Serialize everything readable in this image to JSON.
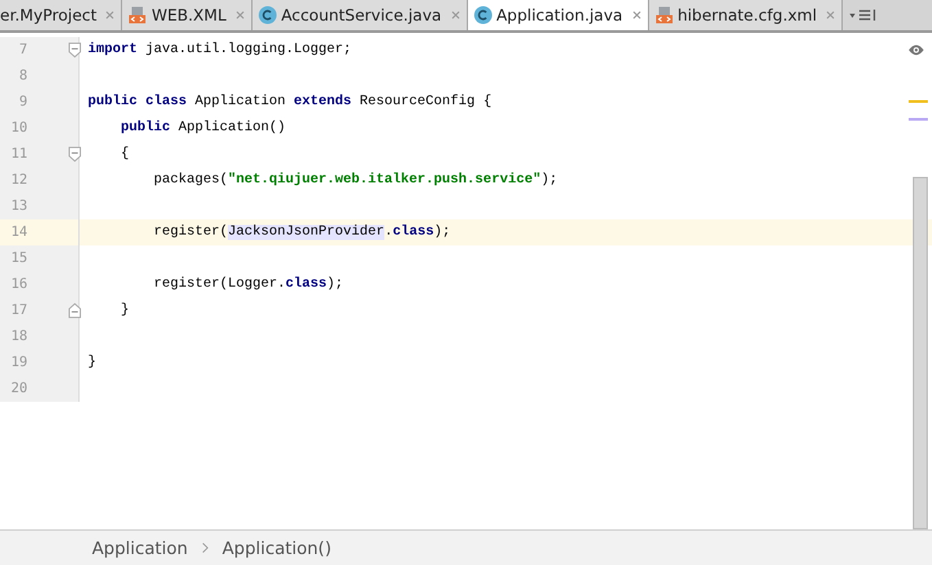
{
  "tabs": [
    {
      "label": "er.MyProject",
      "kind": "plain",
      "selected": false
    },
    {
      "label": "WEB.XML",
      "kind": "xml",
      "selected": false
    },
    {
      "label": "AccountService.java",
      "kind": "class",
      "selected": false
    },
    {
      "label": "Application.java",
      "kind": "class",
      "selected": true
    },
    {
      "label": "hibernate.cfg.xml",
      "kind": "xml",
      "selected": false
    }
  ],
  "code_lines": [
    {
      "number": "7",
      "current": false,
      "kind": "fold-start",
      "tokens": [
        {
          "kind": "keyword",
          "text": "import"
        },
        {
          "kind": "plain",
          "text": " java.util.logging.Logger;"
        }
      ]
    },
    {
      "number": "8",
      "current": false,
      "kind": "plain"
    },
    {
      "number": "9",
      "current": false,
      "kind": "plain",
      "tokens": [
        {
          "kind": "keyword",
          "text": "public class"
        },
        {
          "kind": "plain",
          "text": " Application "
        },
        {
          "kind": "keyword",
          "text": "extends"
        },
        {
          "kind": "plain",
          "text": " ResourceConfig {"
        }
      ]
    },
    {
      "number": "10",
      "current": false,
      "kind": "plain",
      "tokens": [
        {
          "kind": "keyword",
          "text": "    public"
        },
        {
          "kind": "plain",
          "text": " Application()"
        }
      ]
    },
    {
      "number": "11",
      "current": false,
      "kind": "fold-start",
      "tokens": [
        {
          "kind": "plain",
          "text": "    {"
        }
      ]
    },
    {
      "number": "12",
      "current": false,
      "kind": "plain",
      "tokens": [
        {
          "kind": "plain",
          "text": "        packages("
        },
        {
          "kind": "string",
          "text": "\"net.qiujuer.web.italker.push.service\""
        },
        {
          "kind": "plain",
          "text": ");"
        }
      ]
    },
    {
      "number": "13",
      "current": false,
      "kind": "plain"
    },
    {
      "number": "14",
      "current": true,
      "kind": "plain",
      "tokens": [
        {
          "kind": "plain",
          "text": "        register("
        },
        {
          "kind": "highlight",
          "text": "JacksonJsonProvider"
        },
        {
          "kind": "plain",
          "text": "."
        },
        {
          "kind": "keyword",
          "text": "class"
        },
        {
          "kind": "plain",
          "text": ");"
        }
      ]
    },
    {
      "number": "15",
      "current": false,
      "kind": "plain"
    },
    {
      "number": "16",
      "current": false,
      "kind": "plain",
      "tokens": [
        {
          "kind": "plain",
          "text": "        register(Logger."
        },
        {
          "kind": "keyword",
          "text": "class"
        },
        {
          "kind": "plain",
          "text": ");"
        }
      ]
    },
    {
      "number": "17",
      "current": false,
      "kind": "fold-end",
      "tokens": [
        {
          "kind": "plain",
          "text": "    }"
        }
      ]
    },
    {
      "number": "18",
      "current": false,
      "kind": "plain"
    },
    {
      "number": "19",
      "current": false,
      "kind": "plain",
      "tokens": [
        {
          "kind": "plain",
          "text": "}"
        }
      ]
    },
    {
      "number": "20",
      "current": false,
      "kind": "plain"
    }
  ],
  "breadcrumbs": [
    "Application",
    "Application()"
  ]
}
